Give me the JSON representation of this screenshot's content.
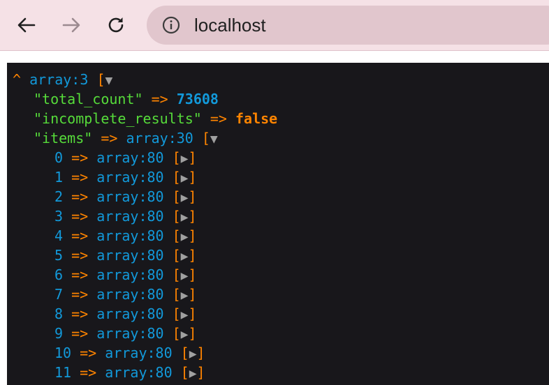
{
  "browser": {
    "url": "localhost",
    "colors": {
      "toolbar_bg": "#f5e1e6",
      "omnibox_bg": "#e1c6cd"
    }
  },
  "dump": {
    "root_caret": "^",
    "root_type": "array:3",
    "open_bracket": "[",
    "expanded_toggle": "▼",
    "collapsed_toggle": "▶",
    "arrow": "=>",
    "entries": [
      {
        "key": "\"total_count\"",
        "value": "73608"
      },
      {
        "key": "\"incomplete_results\"",
        "value": "false"
      },
      {
        "key": "\"items\"",
        "value": "array:30"
      }
    ],
    "items": [
      {
        "index": "0",
        "type": "array:80"
      },
      {
        "index": "1",
        "type": "array:80"
      },
      {
        "index": "2",
        "type": "array:80"
      },
      {
        "index": "3",
        "type": "array:80"
      },
      {
        "index": "4",
        "type": "array:80"
      },
      {
        "index": "5",
        "type": "array:80"
      },
      {
        "index": "6",
        "type": "array:80"
      },
      {
        "index": "7",
        "type": "array:80"
      },
      {
        "index": "8",
        "type": "array:80"
      },
      {
        "index": "9",
        "type": "array:80"
      },
      {
        "index": "10",
        "type": "array:80"
      },
      {
        "index": "11",
        "type": "array:80"
      }
    ],
    "colors": {
      "background": "#18171b",
      "string_key": "#56db3a",
      "operator": "#ff8400",
      "type": "#1299da",
      "toggle": "#a0a0a0"
    }
  }
}
